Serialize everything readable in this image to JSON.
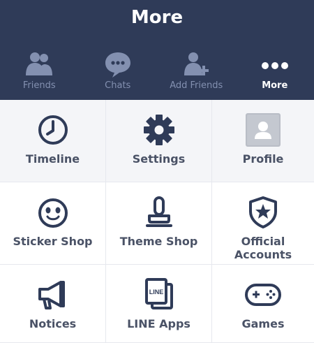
{
  "header": {
    "title": "More"
  },
  "tabs": [
    {
      "label": "Friends",
      "icon": "friends-icon",
      "active": false
    },
    {
      "label": "Chats",
      "icon": "chat-bubble-icon",
      "active": false
    },
    {
      "label": "Add Friends",
      "icon": "add-friend-icon",
      "active": false
    },
    {
      "label": "More",
      "icon": "more-dots-icon",
      "active": true
    }
  ],
  "menu": [
    {
      "label": "Timeline",
      "icon": "clock-icon"
    },
    {
      "label": "Settings",
      "icon": "gear-icon"
    },
    {
      "label": "Profile",
      "icon": "profile-avatar-icon"
    },
    {
      "label": "Sticker Shop",
      "icon": "sticker-face-icon"
    },
    {
      "label": "Theme Shop",
      "icon": "paintbrush-icon"
    },
    {
      "label": "Official Accounts",
      "icon": "star-shield-icon"
    },
    {
      "label": "Notices",
      "icon": "megaphone-icon"
    },
    {
      "label": "LINE Apps",
      "icon": "line-apps-icon"
    },
    {
      "label": "Games",
      "icon": "gamepad-icon"
    }
  ],
  "line_apps_icon_text": "LINE",
  "colors": {
    "header_bg": "#2f3b58",
    "tab_inactive": "#8390b0",
    "tab_active": "#ffffff",
    "icon_dark": "#2f3b58",
    "label": "#4a5266",
    "grid_line": "#e6e8ee"
  }
}
